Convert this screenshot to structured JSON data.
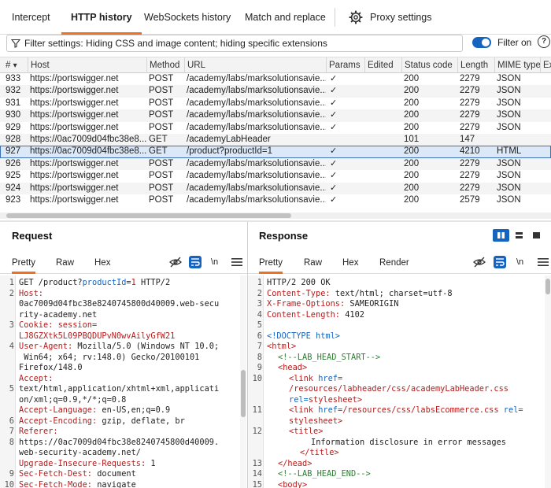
{
  "tabs": [
    "Intercept",
    "HTTP history",
    "WebSockets history",
    "Match and replace",
    "Proxy settings"
  ],
  "filter": {
    "text": "Filter settings: Hiding CSS and image content; hiding specific extensions",
    "toggle_label": "Filter on",
    "help": "?"
  },
  "columns": [
    "#",
    "Host",
    "Method",
    "URL",
    "Params",
    "Edited",
    "Status code",
    "Length",
    "MIME type",
    "Ex"
  ],
  "sort_indicator": "▾",
  "rows": [
    {
      "num": "933",
      "host": "https://portswigger.net",
      "method": "POST",
      "url": "/academy/labs/marksolutionsavie...",
      "params": "✓",
      "status": "200",
      "length": "2279",
      "mime": "JSON"
    },
    {
      "num": "932",
      "host": "https://portswigger.net",
      "method": "POST",
      "url": "/academy/labs/marksolutionsavie...",
      "params": "✓",
      "status": "200",
      "length": "2279",
      "mime": "JSON"
    },
    {
      "num": "931",
      "host": "https://portswigger.net",
      "method": "POST",
      "url": "/academy/labs/marksolutionsavie...",
      "params": "✓",
      "status": "200",
      "length": "2279",
      "mime": "JSON"
    },
    {
      "num": "930",
      "host": "https://portswigger.net",
      "method": "POST",
      "url": "/academy/labs/marksolutionsavie...",
      "params": "✓",
      "status": "200",
      "length": "2279",
      "mime": "JSON"
    },
    {
      "num": "929",
      "host": "https://portswigger.net",
      "method": "POST",
      "url": "/academy/labs/marksolutionsavie...",
      "params": "✓",
      "status": "200",
      "length": "2279",
      "mime": "JSON"
    },
    {
      "num": "928",
      "host": "https://0ac7009d04fbc38e8...",
      "method": "GET",
      "url": "/academyLabHeader",
      "params": "",
      "status": "101",
      "length": "147",
      "mime": ""
    },
    {
      "num": "927",
      "host": "https://0ac7009d04fbc38e8...",
      "method": "GET",
      "url": "/product?productId=1",
      "params": "✓",
      "status": "200",
      "length": "4210",
      "mime": "HTML"
    },
    {
      "num": "926",
      "host": "https://portswigger.net",
      "method": "POST",
      "url": "/academy/labs/marksolutionsavie...",
      "params": "✓",
      "status": "200",
      "length": "2279",
      "mime": "JSON"
    },
    {
      "num": "925",
      "host": "https://portswigger.net",
      "method": "POST",
      "url": "/academy/labs/marksolutionsavie...",
      "params": "✓",
      "status": "200",
      "length": "2279",
      "mime": "JSON"
    },
    {
      "num": "924",
      "host": "https://portswigger.net",
      "method": "POST",
      "url": "/academy/labs/marksolutionsavie...",
      "params": "✓",
      "status": "200",
      "length": "2279",
      "mime": "JSON"
    },
    {
      "num": "923",
      "host": "https://portswigger.net",
      "method": "POST",
      "url": "/academy/labs/marksolutionsavie...",
      "params": "✓",
      "status": "200",
      "length": "2579",
      "mime": "JSON"
    }
  ],
  "selected_row": "927",
  "request": {
    "title": "Request",
    "tabs": [
      "Pretty",
      "Raw",
      "Hex"
    ],
    "newline_label": "\\n",
    "line_numbers": [
      "1",
      "2",
      "",
      "",
      "3",
      "",
      "4",
      "",
      "",
      "",
      "5",
      "",
      "",
      "6",
      "7",
      "8",
      "",
      "",
      "9",
      "10",
      "11"
    ],
    "req_line": {
      "a": "GET /product?",
      "b": "productId",
      "c": "=",
      "d": "1",
      "e": " HTTP/2"
    },
    "host_key": "Host:",
    "host_val_1": "0ac7009d04fbc38e8240745800d40009.web-secu",
    "host_val_2": "rity-academy.net",
    "cookie_key": "Cookie:",
    "cookie_name": "session=",
    "cookie_val": "LJ8GZXtk5L09PBQDUPvN0wvAilyGfW21",
    "ua_key": "User-Agent:",
    "ua_1": "Mozilla/5.0 (Windows NT 10.0;",
    "ua_2": " Win64; x64; rv:148.0) Gecko/20100101",
    "ua_3": "Firefox/148.0",
    "accept_key": "Accept:",
    "accept_1": "text/html,application/xhtml+xml,applicati",
    "accept_2": "on/xml;q=0.9,*/*;q=0.8",
    "al_key": "Accept-Language:",
    "al_val": "en-US,en;q=0.9",
    "ae_key": "Accept-Encoding:",
    "ae_val": "gzip, deflate, br",
    "ref_key": "Referer:",
    "ref_1": "https://0ac7009d04fbc38e8240745800d40009.",
    "ref_2": "web-security-academy.net/",
    "uir_key": "Upgrade-Insecure-Requests:",
    "uir_val": "1",
    "sfd_key": "Sec-Fetch-Dest:",
    "sfd_val": "document",
    "sfm_key": "Sec-Fetch-Mode:",
    "sfm_val": "navigate"
  },
  "response": {
    "title": "Response",
    "tabs": [
      "Pretty",
      "Raw",
      "Hex",
      "Render"
    ],
    "newline_label": "\\n",
    "line_numbers": [
      "1",
      "2",
      "3",
      "4",
      "5",
      "6",
      "7",
      "8",
      "9",
      "10",
      "",
      "",
      "11",
      "",
      "12",
      "",
      "",
      "13",
      "14",
      "15"
    ],
    "status_line": "HTTP/2 200 OK",
    "ct_key": "Content-Type:",
    "ct_val": "text/html; charset=utf-8",
    "xfo_key": "X-Frame-Options:",
    "xfo_val": "SAMEORIGIN",
    "cl_key": "Content-Length:",
    "cl_val": "4102",
    "doctype": "<!DOCTYPE html>",
    "html_open": "<html>",
    "lab_head_start": "<!--LAB_HEAD_START-->",
    "head_open": "<head>",
    "link_tag": "<link",
    "href_attr": "href=",
    "href_val_1": "/resources/labheader/css/academyLabHeader.css",
    "rel_attr": "rel=",
    "rel_val": "stylesheet",
    "close_angle": ">",
    "href_val_2": "/resources/css/labsEcommerce.css",
    "rel_attr_2": "rel=",
    "title_open": "<title>",
    "title_text": "Information disclosure in error messages",
    "title_close": "</title>",
    "head_close": "</head>",
    "lab_head_end": "<!--LAB_HEAD_END-->",
    "body_open": "<body>"
  }
}
